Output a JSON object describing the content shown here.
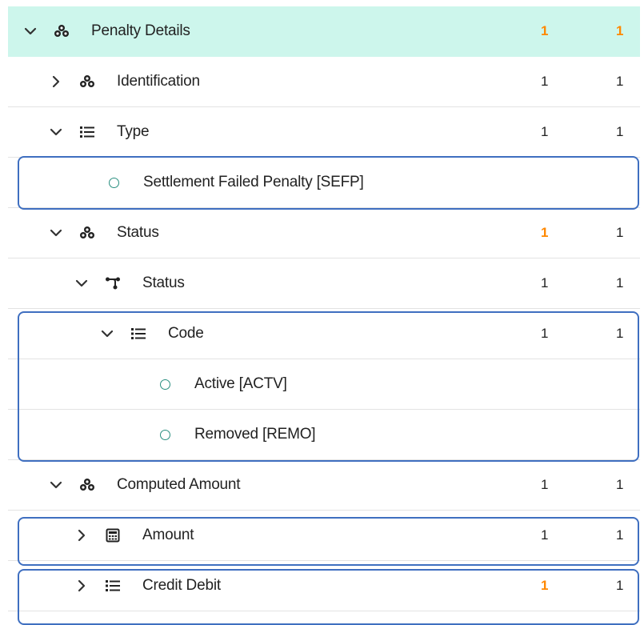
{
  "rows": [
    {
      "label": "Penalty Details",
      "min": "1",
      "max": "1",
      "min_color": "orange",
      "max_color": "orange",
      "icon": "group-icon",
      "chevron": "down",
      "selected": true
    },
    {
      "label": "Identification",
      "min": "1",
      "max": "1",
      "icon": "group-icon",
      "chevron": "right"
    },
    {
      "label": "Type",
      "min": "1",
      "max": "1",
      "icon": "list-icon",
      "chevron": "down"
    },
    {
      "label": "Settlement Failed Penalty [SEFP]",
      "icon": "radio-option-icon"
    },
    {
      "label": "Status",
      "min": "1",
      "max": "1",
      "min_color": "orange",
      "icon": "group-icon",
      "chevron": "down"
    },
    {
      "label": "Status",
      "min": "1",
      "max": "1",
      "icon": "choice-branch-icon",
      "chevron": "down"
    },
    {
      "label": "Code",
      "min": "1",
      "max": "1",
      "icon": "list-icon",
      "chevron": "down"
    },
    {
      "label": "Active [ACTV]",
      "icon": "radio-option-icon"
    },
    {
      "label": "Removed [REMO]",
      "icon": "radio-option-icon"
    },
    {
      "label": "Computed Amount",
      "min": "1",
      "max": "1",
      "icon": "group-icon",
      "chevron": "down"
    },
    {
      "label": "Amount",
      "min": "1",
      "max": "1",
      "icon": "calculator-icon",
      "chevron": "right"
    },
    {
      "label": "Credit Debit",
      "min": "1",
      "max": "1",
      "min_color": "orange",
      "icon": "list-icon",
      "chevron": "right"
    }
  ],
  "colors": {
    "selected_background": "#cdf6ec",
    "highlight_border": "#3f6fc0",
    "orange": "#ff8800",
    "radio": "#2a8f80"
  }
}
